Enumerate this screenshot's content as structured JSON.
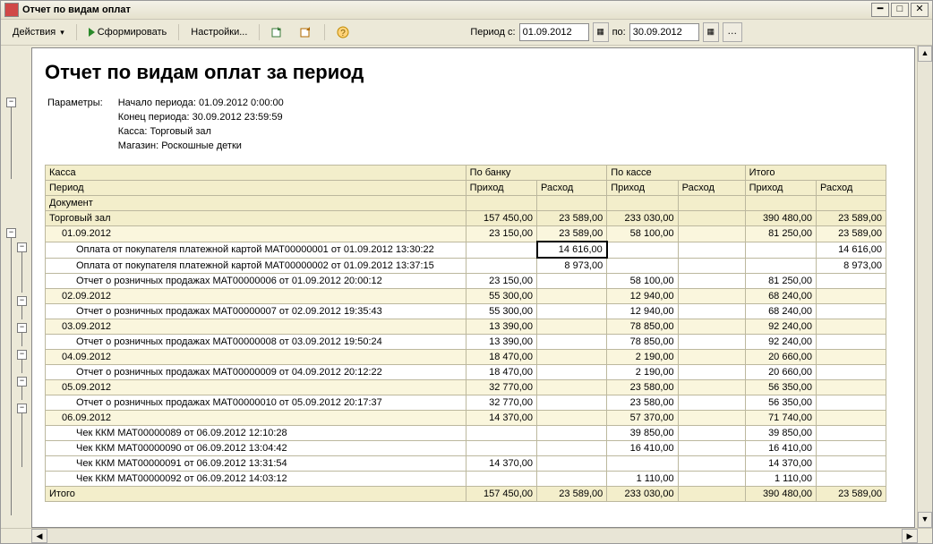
{
  "window": {
    "title": "Отчет по видам оплат"
  },
  "toolbar": {
    "actions_label": "Действия",
    "form_label": "Сформировать",
    "settings_label": "Настройки...",
    "period_label": "Период с:",
    "period_from": "01.09.2012",
    "period_to_label": "по:",
    "period_to": "30.09.2012"
  },
  "report": {
    "title": "Отчет по видам оплат за период",
    "params_label": "Параметры:",
    "params": [
      "Начало периода: 01.09.2012 0:00:00",
      "Конец периода: 30.09.2012 23:59:59",
      "Касса: Торговый зал",
      "Магазин: Роскошные детки"
    ],
    "headers": {
      "left": [
        "Касса",
        "Период",
        "Документ"
      ],
      "groups": [
        "По банку",
        "По кассе",
        "Итого"
      ],
      "cols": [
        "Приход",
        "Расход"
      ]
    },
    "total_label": "Итого",
    "rows": [
      {
        "lvl": 0,
        "label": "Торговый зал",
        "v": [
          "157 450,00",
          "23 589,00",
          "233 030,00",
          "",
          "390 480,00",
          "23 589,00"
        ]
      },
      {
        "lvl": 1,
        "label": "01.09.2012",
        "v": [
          "23 150,00",
          "23 589,00",
          "58 100,00",
          "",
          "81 250,00",
          "23 589,00"
        ]
      },
      {
        "lvl": 2,
        "label": "Оплата от покупателя платежной картой МАТ00000001 от 01.09.2012 13:30:22",
        "v": [
          "",
          "14 616,00",
          "",
          "",
          "",
          "14 616,00"
        ],
        "sel": 1
      },
      {
        "lvl": 2,
        "label": "Оплата от покупателя платежной картой МАТ00000002 от 01.09.2012 13:37:15",
        "v": [
          "",
          "8 973,00",
          "",
          "",
          "",
          "8 973,00"
        ]
      },
      {
        "lvl": 2,
        "label": "Отчет о розничных продажах МАТ00000006 от 01.09.2012 20:00:12",
        "v": [
          "23 150,00",
          "",
          "58 100,00",
          "",
          "81 250,00",
          ""
        ]
      },
      {
        "lvl": 1,
        "label": "02.09.2012",
        "v": [
          "55 300,00",
          "",
          "12 940,00",
          "",
          "68 240,00",
          ""
        ]
      },
      {
        "lvl": 2,
        "label": "Отчет о розничных продажах МАТ00000007 от 02.09.2012 19:35:43",
        "v": [
          "55 300,00",
          "",
          "12 940,00",
          "",
          "68 240,00",
          ""
        ]
      },
      {
        "lvl": 1,
        "label": "03.09.2012",
        "v": [
          "13 390,00",
          "",
          "78 850,00",
          "",
          "92 240,00",
          ""
        ]
      },
      {
        "lvl": 2,
        "label": "Отчет о розничных продажах МАТ00000008 от 03.09.2012 19:50:24",
        "v": [
          "13 390,00",
          "",
          "78 850,00",
          "",
          "92 240,00",
          ""
        ]
      },
      {
        "lvl": 1,
        "label": "04.09.2012",
        "v": [
          "18 470,00",
          "",
          "2 190,00",
          "",
          "20 660,00",
          ""
        ]
      },
      {
        "lvl": 2,
        "label": "Отчет о розничных продажах МАТ00000009 от 04.09.2012 20:12:22",
        "v": [
          "18 470,00",
          "",
          "2 190,00",
          "",
          "20 660,00",
          ""
        ]
      },
      {
        "lvl": 1,
        "label": "05.09.2012",
        "v": [
          "32 770,00",
          "",
          "23 580,00",
          "",
          "56 350,00",
          ""
        ]
      },
      {
        "lvl": 2,
        "label": "Отчет о розничных продажах МАТ00000010 от 05.09.2012 20:17:37",
        "v": [
          "32 770,00",
          "",
          "23 580,00",
          "",
          "56 350,00",
          ""
        ]
      },
      {
        "lvl": 1,
        "label": "06.09.2012",
        "v": [
          "14 370,00",
          "",
          "57 370,00",
          "",
          "71 740,00",
          ""
        ]
      },
      {
        "lvl": 2,
        "label": "Чек ККМ МАТ00000089 от 06.09.2012 12:10:28",
        "v": [
          "",
          "",
          "39 850,00",
          "",
          "39 850,00",
          ""
        ]
      },
      {
        "lvl": 2,
        "label": "Чек ККМ МАТ00000090 от 06.09.2012 13:04:42",
        "v": [
          "",
          "",
          "16 410,00",
          "",
          "16 410,00",
          ""
        ]
      },
      {
        "lvl": 2,
        "label": "Чек ККМ МАТ00000091 от 06.09.2012 13:31:54",
        "v": [
          "14 370,00",
          "",
          "",
          "",
          "14 370,00",
          ""
        ]
      },
      {
        "lvl": 2,
        "label": "Чек ККМ МАТ00000092 от 06.09.2012 14:03:12",
        "v": [
          "",
          "",
          "1 110,00",
          "",
          "1 110,00",
          ""
        ]
      }
    ],
    "totals": [
      "157 450,00",
      "23 589,00",
      "233 030,00",
      "",
      "390 480,00",
      "23 589,00"
    ]
  }
}
